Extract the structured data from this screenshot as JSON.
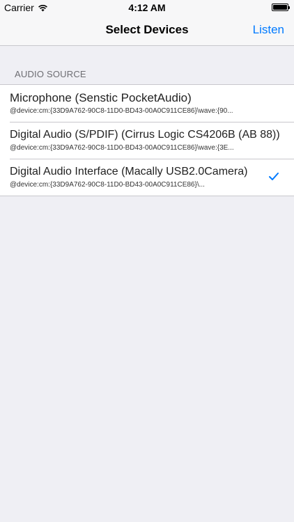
{
  "status_bar": {
    "carrier": "Carrier",
    "time": "4:12 AM",
    "battery_level": 1.0
  },
  "nav": {
    "title": "Select Devices",
    "action_label": "Listen"
  },
  "section": {
    "header": "AUDIO SOURCE"
  },
  "devices": [
    {
      "name": "Microphone (Senstic PocketAudio)",
      "path": "@device:cm:{33D9A762-90C8-11D0-BD43-00A0C911CE86}\\wave:{90...",
      "selected": false
    },
    {
      "name": "Digital Audio (S/PDIF) (Cirrus Logic CS4206B (AB 88))",
      "path": "@device:cm:{33D9A762-90C8-11D0-BD43-00A0C911CE86}\\wave:{3E...",
      "selected": false
    },
    {
      "name": "Digital Audio Interface (Macally USB2.0Camera)",
      "path": "@device:cm:{33D9A762-90C8-11D0-BD43-00A0C911CE86}\\...",
      "selected": true
    }
  ],
  "icons": {
    "wifi": "wifi-icon",
    "battery": "battery-icon",
    "checkmark": "checkmark-icon"
  },
  "colors": {
    "tint": "#007aff",
    "background": "#efeff4",
    "separator": "#c8c7cc"
  }
}
